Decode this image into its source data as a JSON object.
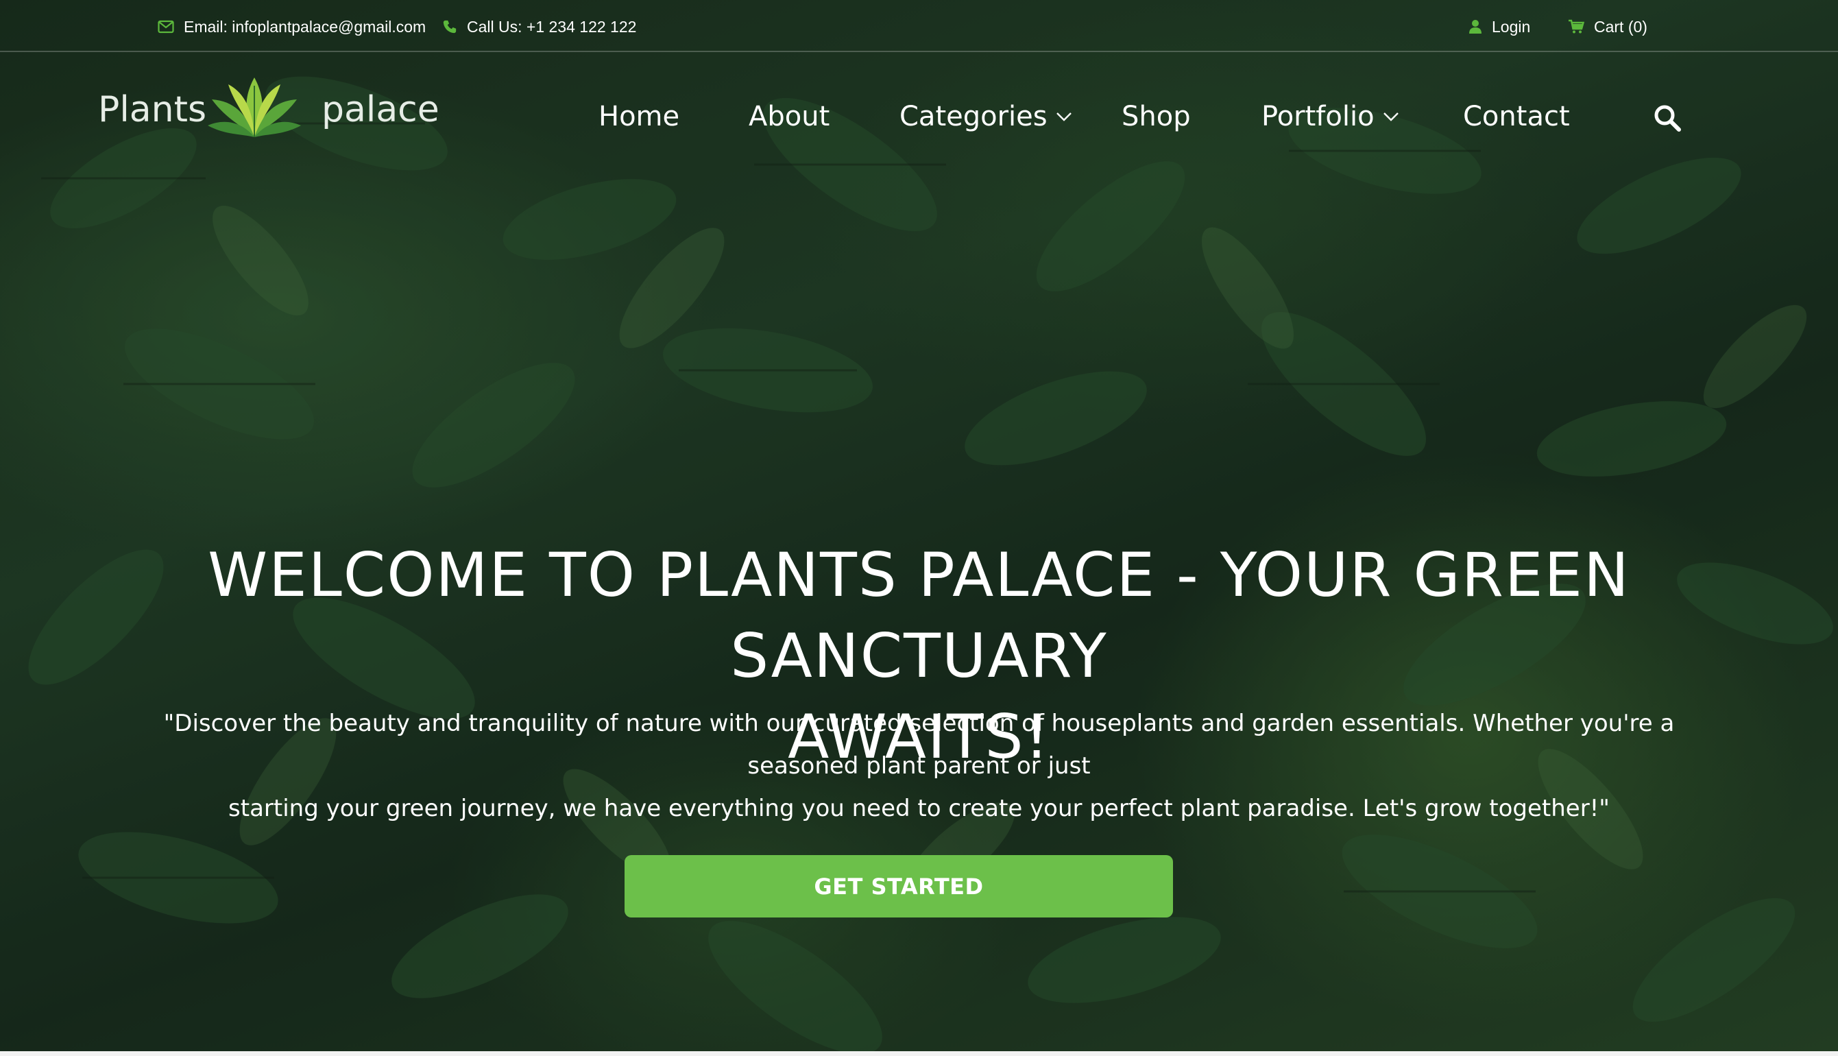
{
  "topbar": {
    "email": "Email: infoplantpalace@gmail.com",
    "phone": "Call Us: +1 234 122 122",
    "login": "Login",
    "cart": "Cart (0)"
  },
  "logo": {
    "word1": "Plants",
    "word2": "palace"
  },
  "nav": {
    "items": [
      {
        "label": "Home"
      },
      {
        "label": "About"
      },
      {
        "label": "Categories",
        "has_dropdown": true
      },
      {
        "label": "Shop"
      },
      {
        "label": "Portfolio",
        "has_dropdown": true
      },
      {
        "label": "Contact"
      }
    ],
    "search_icon": "search-icon"
  },
  "hero": {
    "title_line1": "WELCOME TO PLANTS PALACE - YOUR GREEN SANCTUARY",
    "title_line2": "AWAITS!",
    "subtitle_line1": "\"Discover the beauty and tranquility of nature with our curated selection of houseplants and garden essentials. Whether you're a seasoned plant parent or just",
    "subtitle_line2": "starting your green journey, we have everything you need to create your perfect plant paradise. Let's grow together!\"",
    "cta_label": "GET STARTED"
  },
  "colors": {
    "accent_green": "#6cc04a",
    "icon_green": "#5cb83c",
    "text": "#ffffff"
  }
}
